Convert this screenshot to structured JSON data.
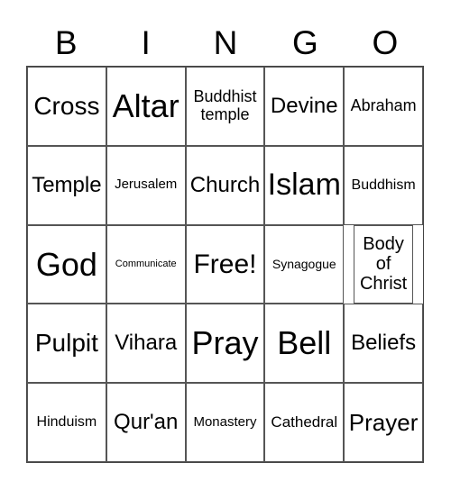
{
  "header": [
    "B",
    "I",
    "N",
    "G",
    "O"
  ],
  "cells": [
    "Cross",
    "Altar",
    "Buddhist temple",
    "Devine",
    "Abraham",
    "Temple",
    "Jerusalem",
    "Church",
    "Islam",
    "Buddhism",
    "God",
    "Communicate",
    "Free!",
    "Synagogue",
    "Body of Christ",
    "Pulpit",
    "Vihara",
    "Pray",
    "Bell",
    "Beliefs",
    "Hinduism",
    "Qur'an",
    "Monastery",
    "Cathedral",
    "Prayer"
  ]
}
